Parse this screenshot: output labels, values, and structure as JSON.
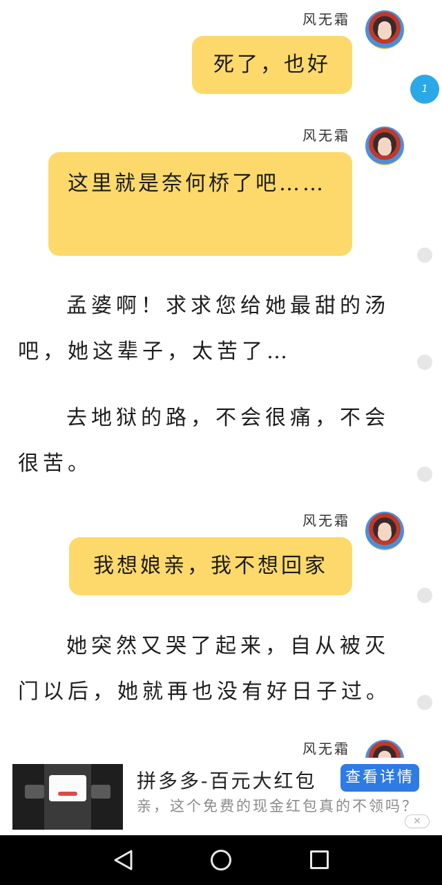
{
  "messages": [
    {
      "sender": "风无霜",
      "text": "死了，也好"
    },
    {
      "sender": "风无霜",
      "text": "这里就是奈何桥了吧……"
    },
    {
      "sender": "风无霜",
      "text": "我想娘亲，我不想回家"
    },
    {
      "sender": "风无霜"
    }
  ],
  "paragraphs": [
    "孟婆啊！求求您给她最甜的汤吧，她这辈子，太苦了…",
    "去地狱的路，不会很痛，不会很苦。",
    "她突然又哭了起来，自从被灭门以后，她就再也没有好日子过。"
  ],
  "unread_badge": "1",
  "ad": {
    "title": "拼多多-百元大红包",
    "description": "亲，这个免费的现金红包真的不领吗？",
    "button_label": "查看详情",
    "close_symbol": "✕"
  },
  "colors": {
    "bubble": "#fcd96a",
    "badge": "#2aa8e8",
    "ad_button": "#2d7be3"
  },
  "icons": {
    "nav_back": "triangle-back-icon",
    "nav_home": "circle-home-icon",
    "nav_recent": "square-recents-icon"
  }
}
